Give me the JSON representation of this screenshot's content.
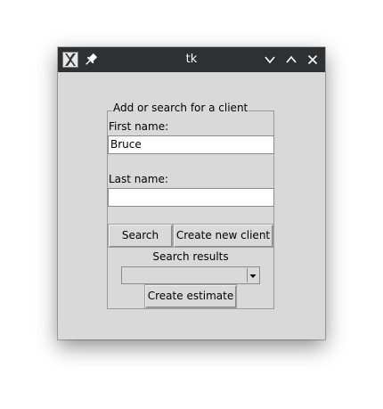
{
  "window": {
    "title": "tk",
    "icons": {
      "app": "x11-app-icon",
      "pin": "pin-icon",
      "minimize": "chevron-down-icon",
      "maximize": "chevron-up-icon",
      "close": "close-icon"
    }
  },
  "form": {
    "frame_label": "Add or search for a client",
    "first_name_label": "First name:",
    "first_name_value": "Bruce",
    "last_name_label": "Last name:",
    "last_name_value": "",
    "search_button": "Search",
    "create_client_button": "Create new client",
    "search_results_label": "Search results",
    "search_results_selected": "",
    "create_estimate_button": "Create estimate"
  }
}
